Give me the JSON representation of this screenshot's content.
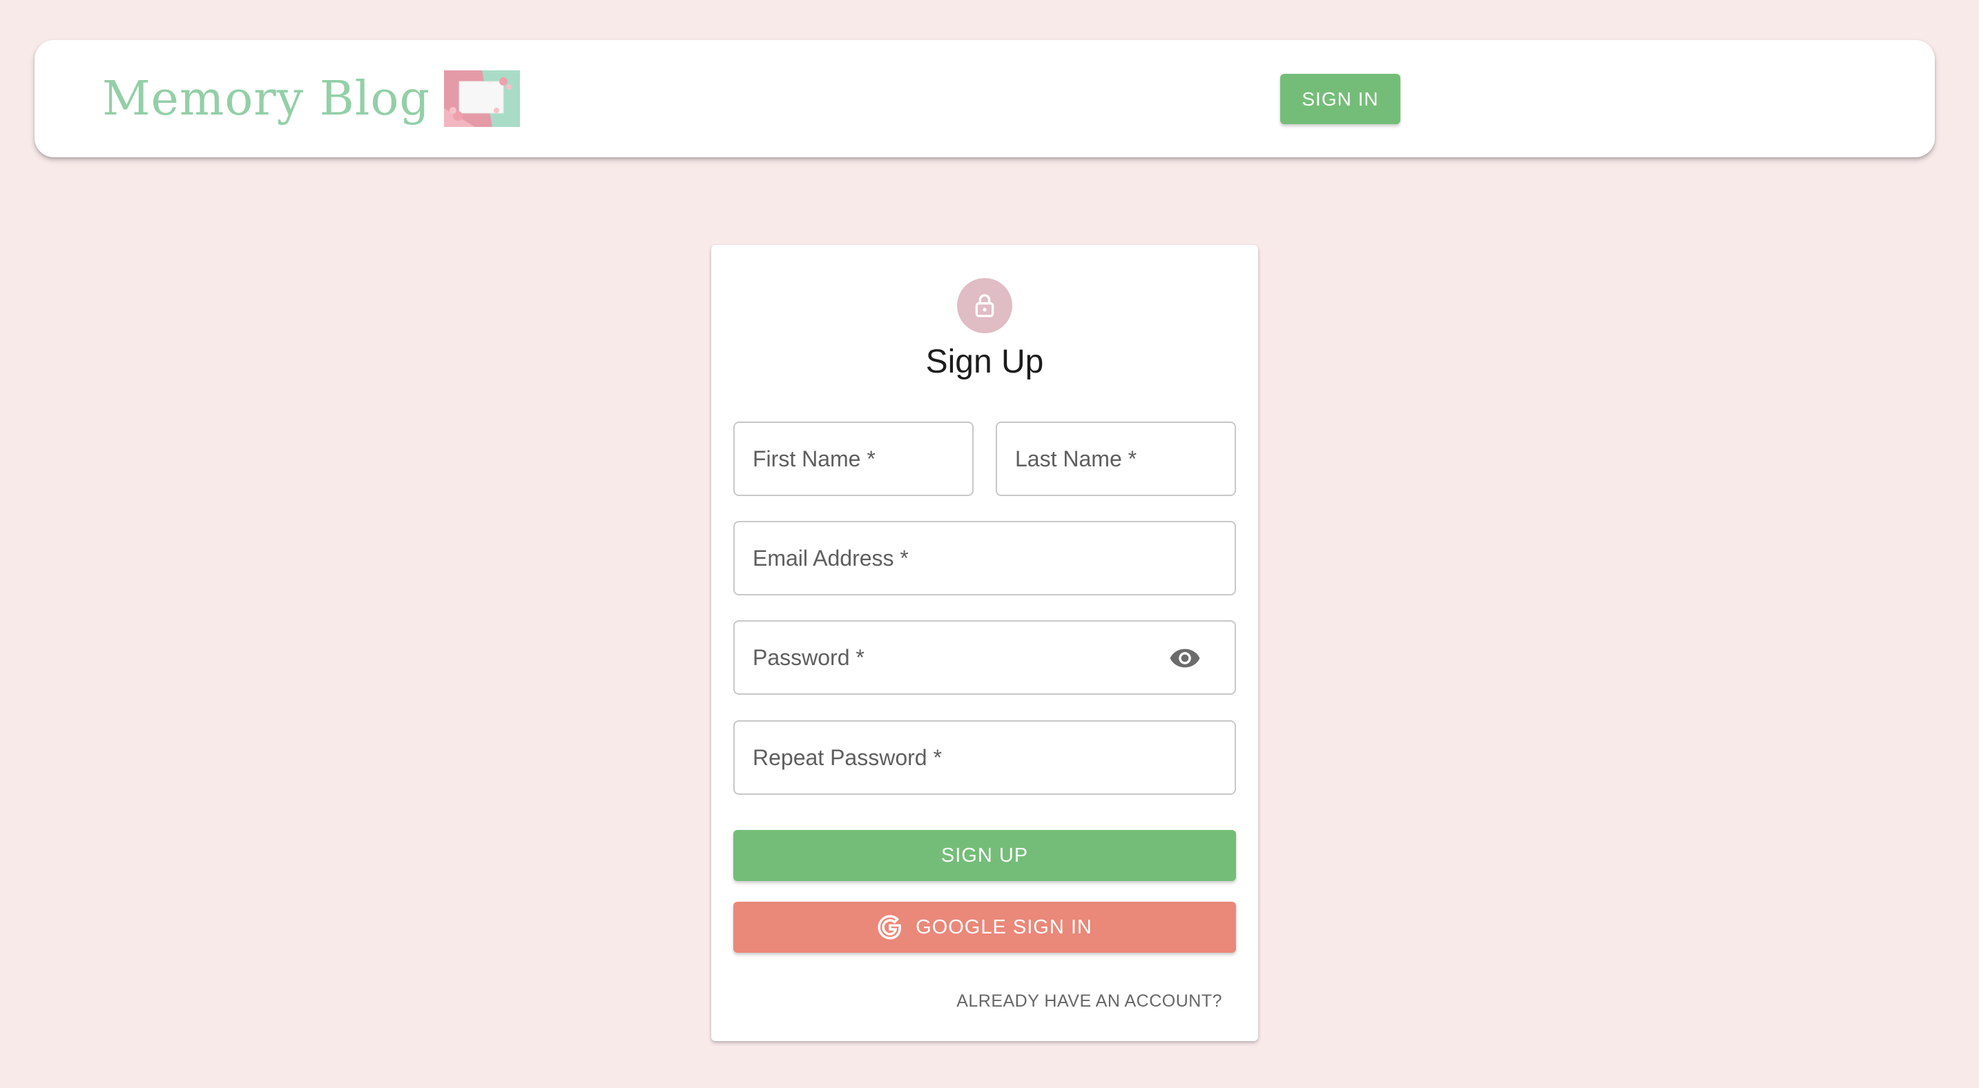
{
  "header": {
    "brand_title": "Memory Blog",
    "sign_in_label": "SIGN IN"
  },
  "form": {
    "title": "Sign Up",
    "fields": {
      "first_name": "First Name *",
      "last_name": "Last Name *",
      "email": "Email Address *",
      "password": "Password *",
      "repeat_password": "Repeat Password *"
    },
    "submit_label": "SIGN UP",
    "google_label": "GOOGLE SIGN IN",
    "switch_label": "ALREADY HAVE AN ACCOUNT?"
  },
  "icons": {
    "brand_image": "memory-card-image",
    "avatar": "lock-icon",
    "password_toggle": "eye-icon",
    "google": "google-icon"
  },
  "colors": {
    "page_background": "#f9eaea",
    "brand_green": "#93cfa7",
    "button_green": "#74bd78",
    "google_red": "#ea8879",
    "avatar_pink": "#e0bcc4"
  }
}
